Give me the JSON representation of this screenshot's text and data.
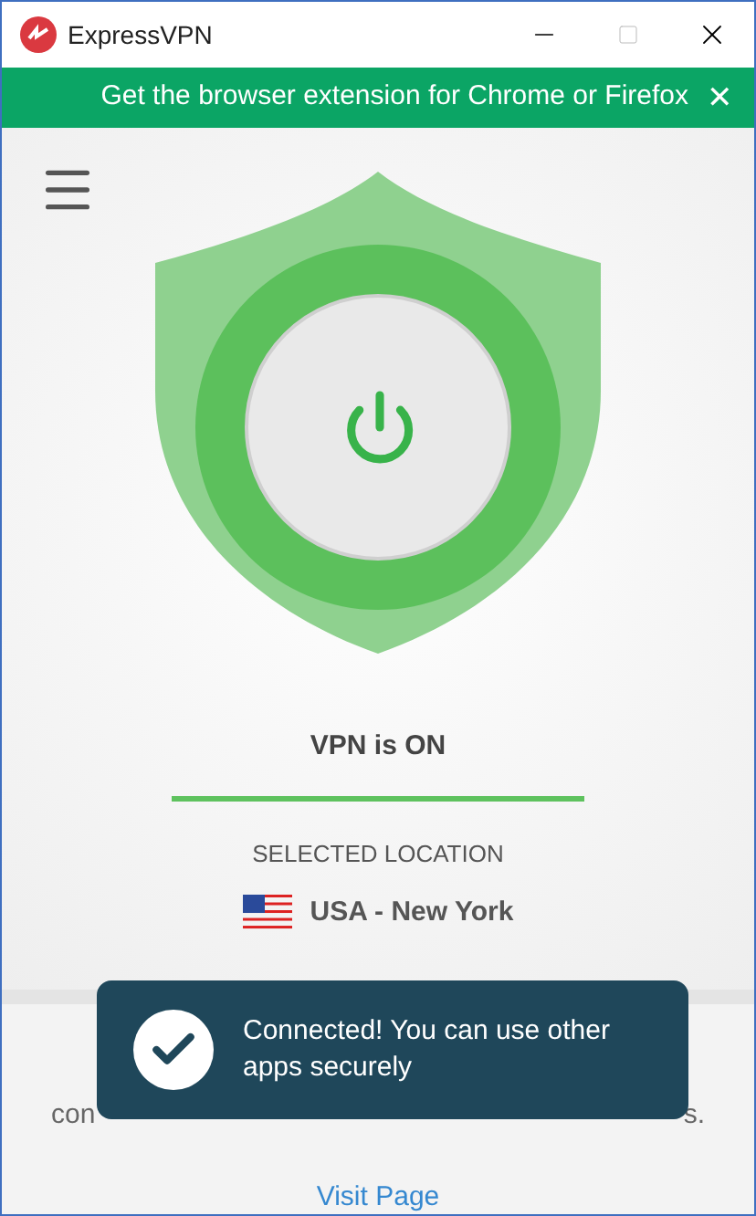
{
  "window": {
    "title": "ExpressVPN"
  },
  "banner": {
    "text": "Get the browser extension for Chrome or Firefox",
    "close": "✕"
  },
  "status": {
    "connected": true,
    "text": "VPN is ON"
  },
  "location": {
    "label": "SELECTED LOCATION",
    "name": "USA - New York"
  },
  "hidden_text": {
    "left": "con",
    "right": "s."
  },
  "toast": {
    "text": "Connected! You can use other apps securely"
  },
  "link": "Visit Page"
}
